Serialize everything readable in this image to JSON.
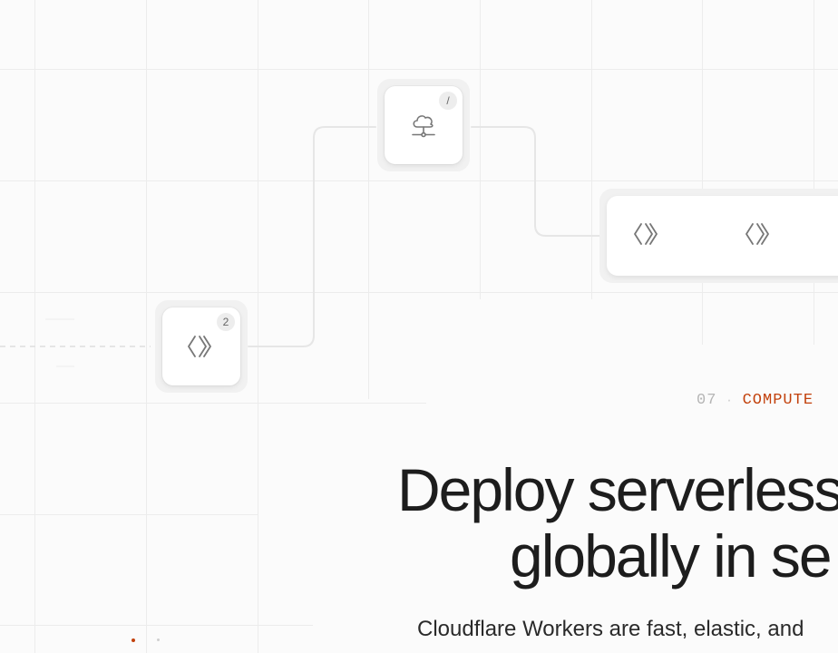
{
  "diagram": {
    "gateway_node": {
      "icon": "cloud-network-icon",
      "badge": "/"
    },
    "worker_node": {
      "icon": "code-brackets-icon",
      "badge": "2"
    },
    "worker_group": {
      "icons": [
        "code-brackets-icon",
        "code-brackets-icon"
      ]
    }
  },
  "section": {
    "number": "07",
    "separator": "·",
    "label": "COMPUTE"
  },
  "hero": {
    "headline_line1": "Deploy serverless",
    "headline_line2": "globally in se",
    "subtext": "Cloudflare Workers are fast, elastic, and"
  },
  "colors": {
    "accent": "#c2410c",
    "headline": "#1d1d1d",
    "icon_stroke": "#777777",
    "background": "#fbfbfb"
  }
}
